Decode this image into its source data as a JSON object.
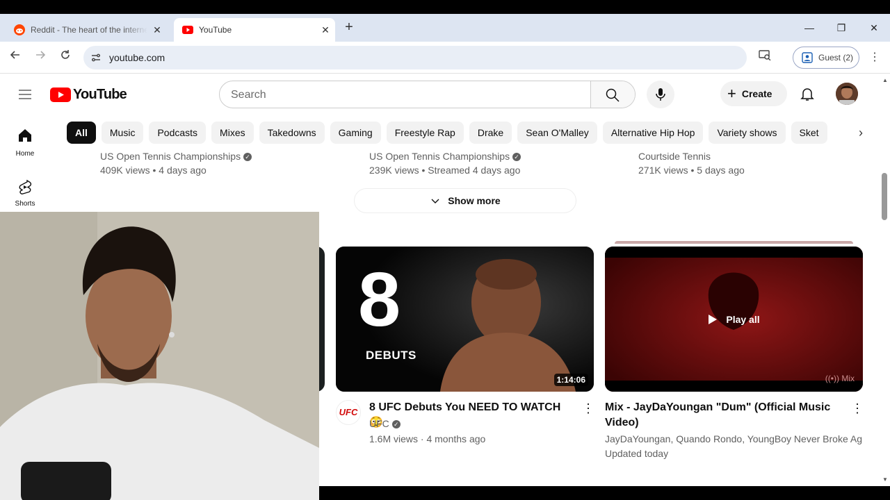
{
  "browser": {
    "tabs": [
      {
        "title": "Reddit - The heart of the internet",
        "active": false
      },
      {
        "title": "YouTube",
        "active": true
      }
    ],
    "url": "youtube.com",
    "profile_label": "Guest (2)",
    "icons": {
      "back": "back-arrow-icon",
      "forward": "forward-arrow-icon",
      "reload": "reload-icon"
    }
  },
  "youtube": {
    "logo_text": "YouTube",
    "search_placeholder": "Search",
    "create_label": "Create",
    "chips": [
      "All",
      "Music",
      "Podcasts",
      "Mixes",
      "Takedowns",
      "Gaming",
      "Freestyle Rap",
      "Drake",
      "Sean O'Malley",
      "Alternative Hip Hop",
      "Variety shows",
      "Sket"
    ],
    "sidebar": [
      {
        "label": "Home",
        "icon": "home-icon"
      },
      {
        "label": "Shorts",
        "icon": "shorts-icon"
      }
    ],
    "top_row": [
      {
        "channel": "US Open Tennis Championships",
        "verified": true,
        "stats": "409K views • 4 days ago"
      },
      {
        "channel": "US Open Tennis Championships",
        "verified": true,
        "stats": "239K views • Streamed 4 days ago"
      },
      {
        "channel": "Courtside Tennis",
        "verified": false,
        "stats": "271K views • 5 days ago"
      }
    ],
    "show_more_label": "Show more",
    "videos": [
      {
        "title": "8 UFC Debuts You NEED TO WATCH 😳",
        "channel": "UFC",
        "stats": "1.6M views · 4 months ago",
        "duration": "1:14:06",
        "thumb_big_text": "8",
        "thumb_sub_text": "DEBUTS",
        "channel_avatar_text": "UFC"
      },
      {
        "title": "Mix - JayDaYoungan \"Dum\" (Official Music Video)",
        "channel": "JayDaYoungan, Quando Rondo, YoungBoy Never Broke Ag...",
        "stats": "Updated today",
        "overlay": "Play all",
        "badge": "Mix"
      }
    ]
  },
  "colors": {
    "brand_red": "#ff0000",
    "tabstrip": "#dde5f2",
    "omnibox": "#e9eef6"
  }
}
